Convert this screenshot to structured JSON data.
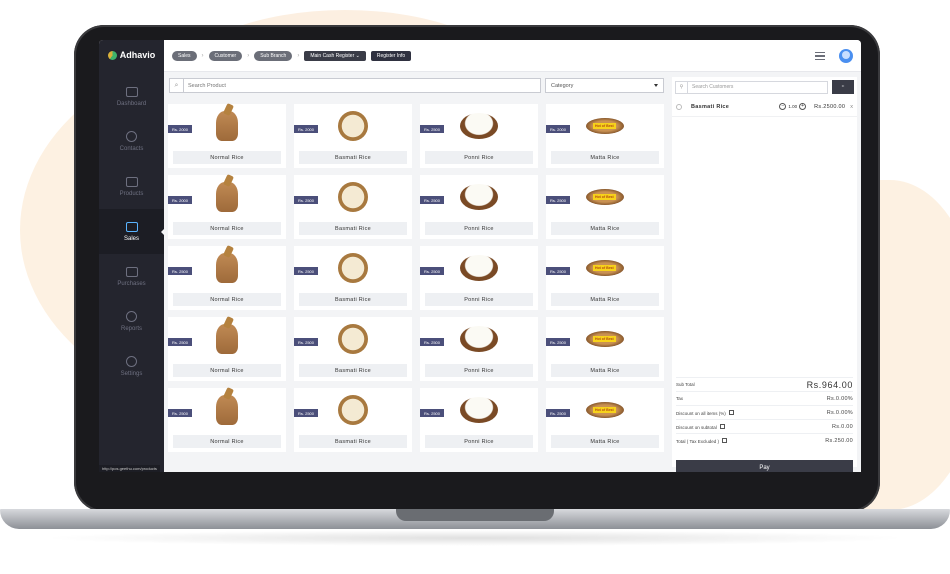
{
  "app": {
    "brand": "Adhavio"
  },
  "sidebar": {
    "items": [
      {
        "label": "Dashboard",
        "icon": "monitor-icon"
      },
      {
        "label": "Contacts",
        "icon": "contacts-icon"
      },
      {
        "label": "Products",
        "icon": "products-icon"
      },
      {
        "label": "Sales",
        "icon": "sales-card-icon",
        "active": true
      },
      {
        "label": "Purchases",
        "icon": "truck-icon"
      },
      {
        "label": "Reports",
        "icon": "pie-chart-icon"
      },
      {
        "label": "Settings",
        "icon": "gear-icon"
      }
    ],
    "url_tooltip": "http://pos.geethu.com/products"
  },
  "breadcrumb": {
    "items": [
      "Sales",
      "Customer",
      "Sub Branch"
    ],
    "register_label": "Main Cash Register",
    "register_info": "Register Info"
  },
  "search": {
    "placeholder": "Search Product",
    "category_label": "Category"
  },
  "products": [
    {
      "name": "Normal Rice",
      "price": "Rs. 2000",
      "image": "sack"
    },
    {
      "name": "Basmati Rice",
      "price": "Rs. 2000",
      "image": "bowl-light"
    },
    {
      "name": "Ponni Rice",
      "price": "Rs. 2500",
      "image": "bowl-white"
    },
    {
      "name": "Matta Rice",
      "price": "Rs. 2000",
      "image": "matta"
    },
    {
      "name": "Normal Rice",
      "price": "Rs. 2000",
      "image": "sack"
    },
    {
      "name": "Basmati Rice",
      "price": "Rs. 2500",
      "image": "bowl-light"
    },
    {
      "name": "Ponni Rice",
      "price": "Rs. 2500",
      "image": "bowl-white"
    },
    {
      "name": "Matta Rice",
      "price": "Rs. 2500",
      "image": "matta"
    },
    {
      "name": "Normal Rice",
      "price": "Rs. 2500",
      "image": "sack"
    },
    {
      "name": "Basmati Rice",
      "price": "Rs. 2500",
      "image": "bowl-light"
    },
    {
      "name": "Ponni Rice",
      "price": "Rs. 2500",
      "image": "bowl-white"
    },
    {
      "name": "Matta Rice",
      "price": "Rs. 2500",
      "image": "matta"
    },
    {
      "name": "Normal Rice",
      "price": "Rs. 2500",
      "image": "sack"
    },
    {
      "name": "Basmati Rice",
      "price": "Rs. 2500",
      "image": "bowl-light"
    },
    {
      "name": "Ponni Rice",
      "price": "Rs. 2500",
      "image": "bowl-white"
    },
    {
      "name": "Matta Rice",
      "price": "Rs. 2500",
      "image": "matta"
    },
    {
      "name": "Normal Rice",
      "price": "Rs. 2500",
      "image": "sack"
    },
    {
      "name": "Basmati Rice",
      "price": "Rs. 2500",
      "image": "bowl-light"
    },
    {
      "name": "Ponni Rice",
      "price": "Rs. 2500",
      "image": "bowl-white"
    },
    {
      "name": "Matta Rice",
      "price": "Rs. 2500",
      "image": "matta"
    }
  ],
  "matta_badge": "Hot of Best",
  "cart": {
    "customer_placeholder": "Search Customers",
    "items": [
      {
        "name": "Basmati Rice",
        "qty": "1.00",
        "price": "Rs.2500.00",
        "remove": "x"
      }
    ],
    "totals": {
      "subtotal_label": "Sub Total",
      "subtotal_value": "Rs.964.00",
      "tax_label": "Tax",
      "tax_value": "Rs.0.00%",
      "discount_all_label": "Discount on all items (%)",
      "discount_all_value": "Rs.0.00%",
      "discount_sub_label": "Discount on subtotal",
      "discount_sub_value": "Rs.0.00",
      "total_label": "Total",
      "total_note": "( Tax Excluded )",
      "total_value": "Rs.250.00"
    },
    "pay_label": "Pay"
  },
  "colors": {
    "sidebar": "#24252e",
    "accent": "#3a3c47",
    "price_tag": "#4b4f7a",
    "active_icon": "#5ab4ff"
  }
}
